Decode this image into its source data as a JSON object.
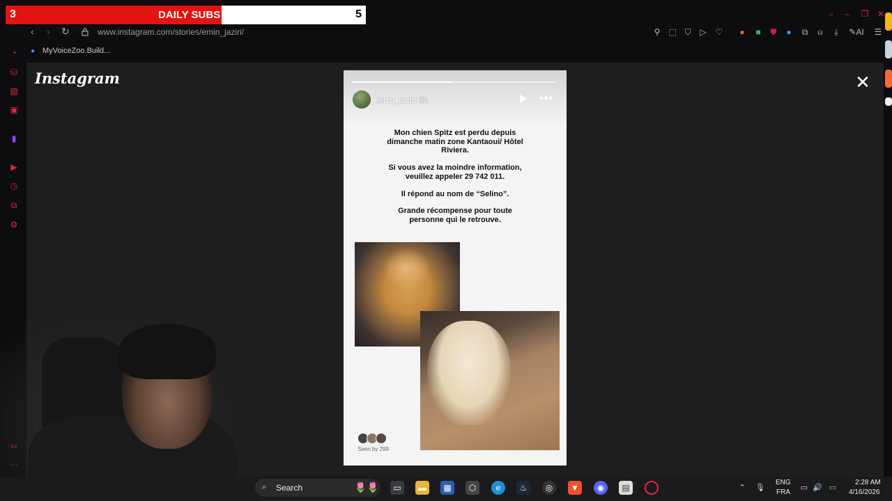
{
  "subs_overlay": {
    "current": "3",
    "title": "DAILY SUBS",
    "goal": "5",
    "progress": 0.6
  },
  "browser": {
    "url": "www.instagram.com/stories/emin_jaziri/",
    "bookmark": "MyVoiceZoo.Build...",
    "toolbar_ai": "AI",
    "accent": "#e0253a"
  },
  "instagram": {
    "logo": "Instagram"
  },
  "story": {
    "username": "emin_jaziri",
    "time_ago": "9h",
    "progress": 0.49,
    "paragraphs": [
      "Mon chien Spitz est perdu depuis dimanche matin zone Kantaoui/ Hôtel Riviera.",
      "Si vous avez la moindre information, veuillez appeler 29 742 011.",
      "Il répond au nom de “Selino”.",
      "Grande récompense pour toute personne qui le retrouve."
    ],
    "seen_by": "Seen by 299"
  },
  "taskbar": {
    "search_label": "Search",
    "lang_primary": "ENG",
    "lang_secondary": "FRA",
    "time": "2:28 AM",
    "date": "4/16/2026"
  }
}
